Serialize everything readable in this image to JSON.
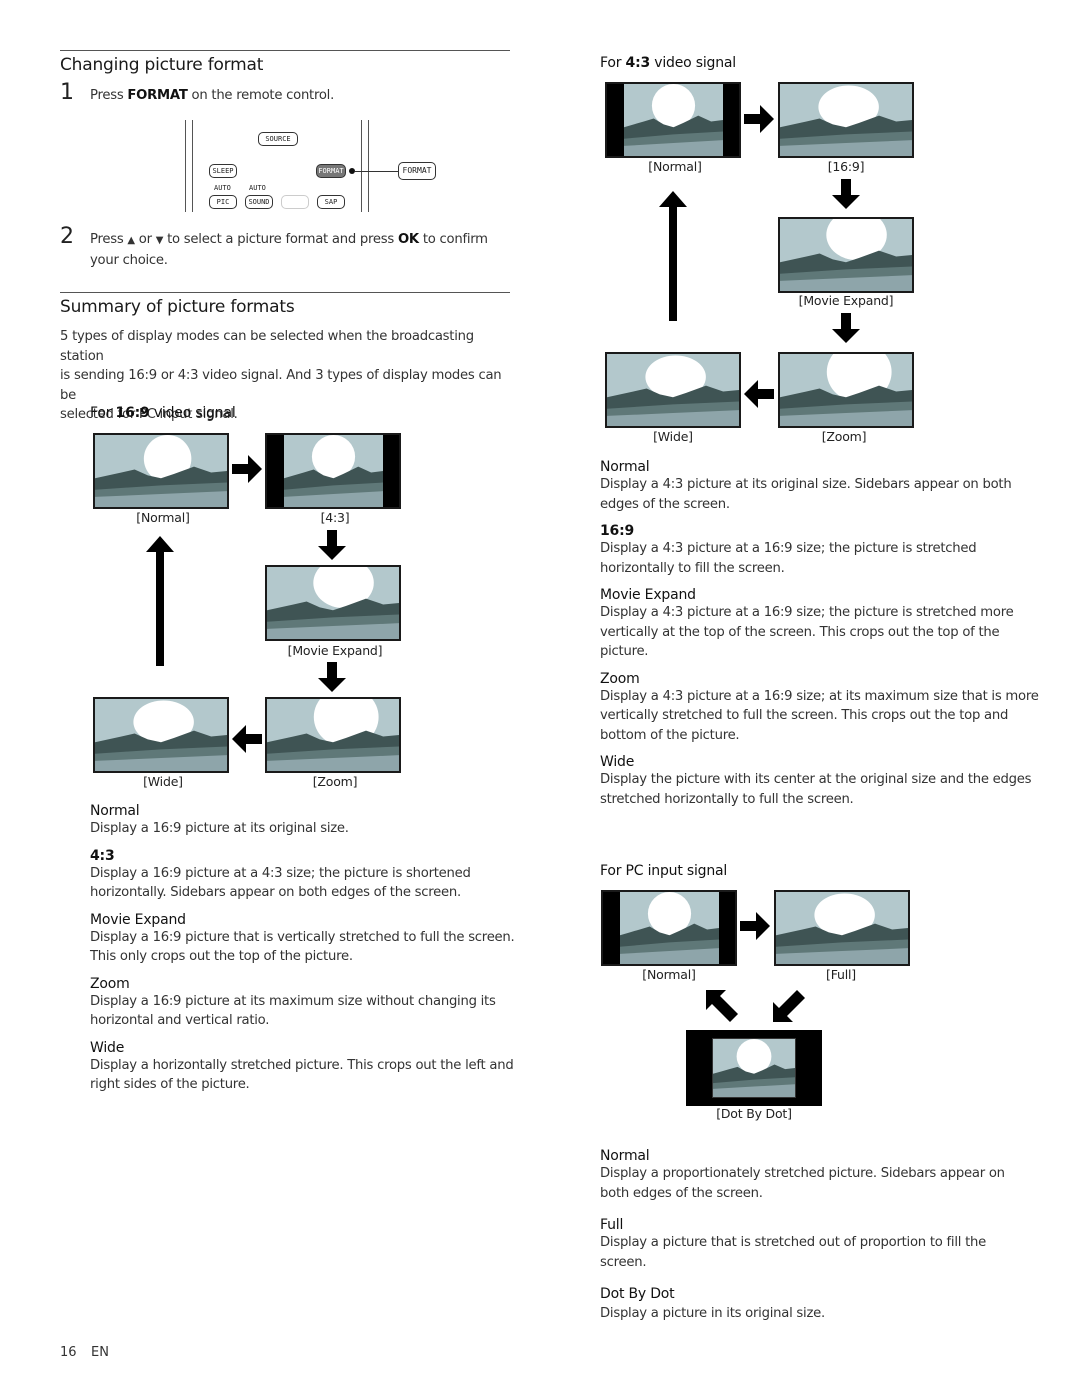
{
  "left": {
    "section1": {
      "title": "Changing picture format",
      "step1": {
        "num": "1",
        "pre": "Press ",
        "bold": "FORMAT",
        "post": " on the remote control."
      },
      "remote": {
        "buttons": [
          "SOURCE",
          "SLEEP",
          "FORMAT",
          "PIC",
          "SOUND",
          "SAP"
        ],
        "labels": [
          "AUTO",
          "AUTO"
        ],
        "callout": "FORMAT"
      },
      "step2": {
        "num": "2",
        "pre": "Press ",
        "up_icon": "▲",
        "mid1": " or ",
        "down_icon": "▼",
        "mid2": " to select a picture format and press ",
        "bold": "OK",
        "post": " to confirm",
        "line2": "your choice."
      }
    },
    "section2": {
      "title": "Summary of picture formats",
      "intro": [
        "5 types of display modes can be selected when the broadcasting station",
        "is sending 16:9 or 4:3 video signal. And 3 types of display modes can be",
        "selected for PC input signal."
      ]
    },
    "signal169": {
      "heading_pre": "For ",
      "heading_bold": "16:9",
      "heading_post": " video signal",
      "captions": {
        "normal": "[Normal]",
        "r43": "[4:3]",
        "movie": "[Movie Expand]",
        "wide": "[Wide]",
        "zoom": "[Zoom]"
      },
      "defs": [
        {
          "title": "Normal",
          "lines": [
            "Display a 16:9 picture at its original size."
          ]
        },
        {
          "title": "4:3",
          "lines": [
            "Display a 16:9 picture at a 4:3 size; the picture is shortened",
            "horizontally. Sidebars appear on both edges of the screen."
          ]
        },
        {
          "title": "Movie Expand",
          "lines": [
            "Display a 16:9 picture that is vertically stretched to full the screen.",
            "This only crops out the top of the picture."
          ]
        },
        {
          "title": "Zoom",
          "lines": [
            "Display a 16:9 picture at its maximum size without changing its",
            "horizontal and vertical ratio."
          ]
        },
        {
          "title": "Wide",
          "lines": [
            "Display a horizontally stretched picture. This crops out the left and",
            "right sides of the picture."
          ]
        }
      ]
    }
  },
  "right": {
    "signal43": {
      "heading_pre": "For ",
      "heading_bold": "4:3",
      "heading_post": " video signal",
      "captions": {
        "normal": "[Normal]",
        "r169": "[16:9]",
        "movie": "[Movie Expand]",
        "wide": "[Wide]",
        "zoom": "[Zoom]"
      },
      "defs": [
        {
          "title": "Normal",
          "lines": [
            "Display a 4:3 picture at its original size. Sidebars appear on both",
            "edges of the screen."
          ]
        },
        {
          "title": "16:9",
          "lines": [
            "Display a 4:3 picture at a 16:9 size; the picture is stretched",
            "horizontally to fill the screen."
          ]
        },
        {
          "title": "Movie Expand",
          "lines": [
            "Display a 4:3 picture at a 16:9 size; the picture is stretched more",
            "vertically at the top of the screen. This crops out the top of the",
            "picture."
          ]
        },
        {
          "title": "Zoom",
          "lines": [
            "Display a 4:3 picture at a 16:9 size; at its maximum size that is more",
            "vertically stretched to full the screen. This crops out the top and",
            "bottom of the picture."
          ]
        },
        {
          "title": "Wide",
          "lines": [
            "Display the picture with its center at the original size and the edges",
            "stretched horizontally to full the screen."
          ]
        }
      ]
    },
    "signalPC": {
      "heading": "For PC input signal",
      "captions": {
        "normal": "[Normal]",
        "full": "[Full]",
        "dot": "[Dot By Dot]"
      },
      "defs": [
        {
          "title": "Normal",
          "lines": [
            "Display a proportionately stretched picture. Sidebars appear on",
            "both edges of the screen."
          ]
        },
        {
          "title": "Full",
          "lines": [
            "Display a picture that is stretched out of proportion to fill the",
            "screen."
          ]
        },
        {
          "title": "Dot By Dot",
          "lines": [
            "Display a picture in its original size."
          ]
        }
      ]
    }
  },
  "footer": {
    "page": "16",
    "lang": "EN"
  },
  "colors": {
    "sky": "#b3c8cc",
    "mountain": "#3f5454",
    "band": "#5f7878",
    "ground": "#8ea5aa",
    "sun": "#ffffff"
  }
}
